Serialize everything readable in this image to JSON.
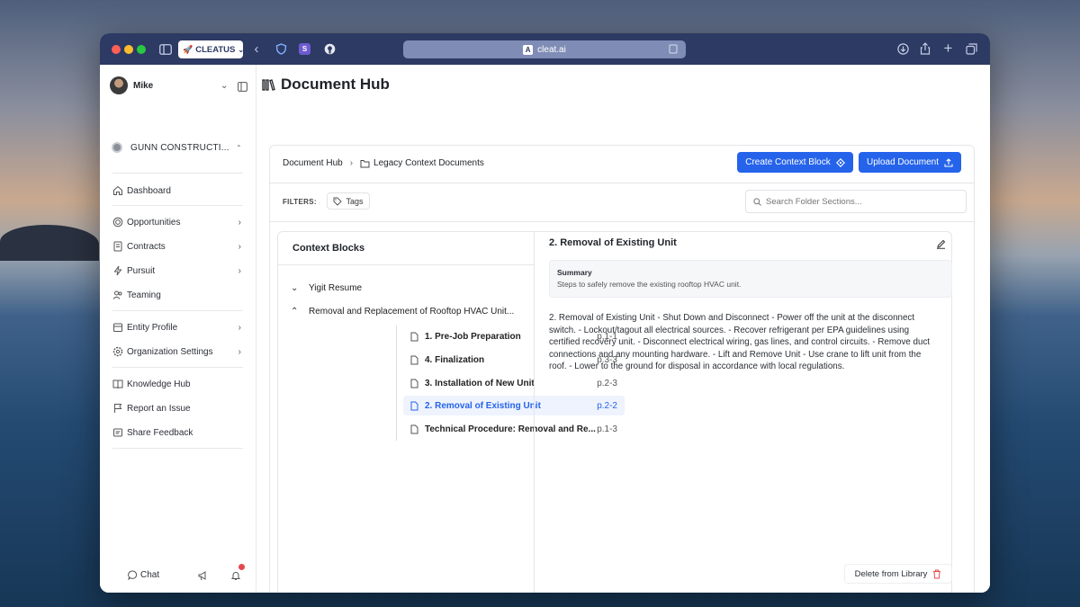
{
  "browser": {
    "profile_label": "CLEATUS",
    "url": "cleat.ai"
  },
  "sidebar": {
    "user_name": "Mike",
    "org_name": "GUNN CONSTRUCTI...",
    "items": [
      {
        "label": "Dashboard"
      },
      {
        "label": "Opportunities"
      },
      {
        "label": "Contracts"
      },
      {
        "label": "Pursuit"
      },
      {
        "label": "Teaming"
      },
      {
        "label": "Entity Profile"
      },
      {
        "label": "Organization Settings"
      },
      {
        "label": "Knowledge Hub"
      },
      {
        "label": "Report an Issue"
      },
      {
        "label": "Share Feedback"
      }
    ],
    "chat_label": "Chat"
  },
  "main": {
    "page_title": "Document Hub",
    "breadcrumb": {
      "root": "Document Hub",
      "current": "Legacy Context Documents"
    },
    "create_button": "Create Context Block",
    "upload_button": "Upload Document",
    "filters_label": "FILTERS:",
    "tags_label": "Tags",
    "search_placeholder": "Search Folder Sections...",
    "context_blocks": {
      "title": "Context Blocks",
      "folder1": "Yigit Resume",
      "folder2": "Removal and Replacement of Rooftop HVAC Unit...",
      "docs": [
        {
          "title": "1. Pre-Job Preparation",
          "page": "p.1-1"
        },
        {
          "title": "4. Finalization",
          "page": "p.3-3"
        },
        {
          "title": "3. Installation of New Unit",
          "page": "p.2-3"
        },
        {
          "title": "2. Removal of Existing Unit",
          "page": "p.2-2"
        },
        {
          "title": "Technical Procedure: Removal and Re...",
          "page": "p.1-3"
        }
      ]
    },
    "detail": {
      "title": "2. Removal of Existing Unit",
      "summary_label": "Summary",
      "summary_text": "Steps to safely remove the existing rooftop HVAC unit.",
      "body": "2. Removal of Existing Unit - Shut Down and Disconnect - Power off the unit at the disconnect switch. - Lockout/tagout all electrical sources. - Recover refrigerant per EPA guidelines using certified recovery unit. - Disconnect electrical wiring, gas lines, and control circuits. - Remove duct connections and any mounting hardware. - Lift and Remove Unit - Use crane to lift unit from the roof. - Lower to the ground for disposal in accordance with local regulations.",
      "delete_button": "Delete from Library"
    }
  },
  "colors": {
    "accent": "#2563eb",
    "titlebar": "#2d3a63",
    "notification": "#e5484d"
  }
}
